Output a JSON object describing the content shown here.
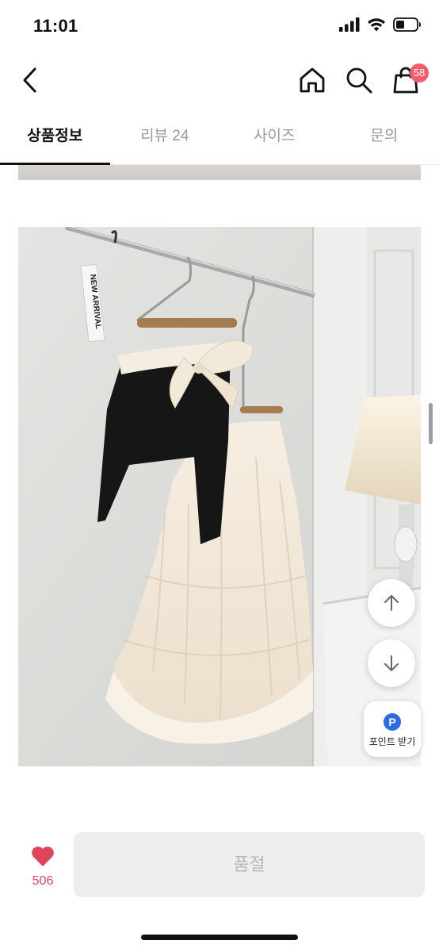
{
  "status_bar": {
    "time": "11:01"
  },
  "header": {
    "cart_count": "58"
  },
  "tabs": [
    {
      "label": "상품정보",
      "active": true
    },
    {
      "label": "리뷰 24",
      "active": false
    },
    {
      "label": "사이즈",
      "active": false
    },
    {
      "label": "문의",
      "active": false
    }
  ],
  "product_photo": {
    "hang_tag_text": "NEW ARRIVAL"
  },
  "floating": {
    "point_icon": "P",
    "point_label": "포인트 받기"
  },
  "bottom": {
    "like_count": "506",
    "soldout_label": "품절"
  },
  "colors": {
    "accent_red": "#e0445a",
    "badge_red": "#f25c6e",
    "point_blue": "#2b6be4",
    "disabled_bg": "#eeeeee"
  }
}
